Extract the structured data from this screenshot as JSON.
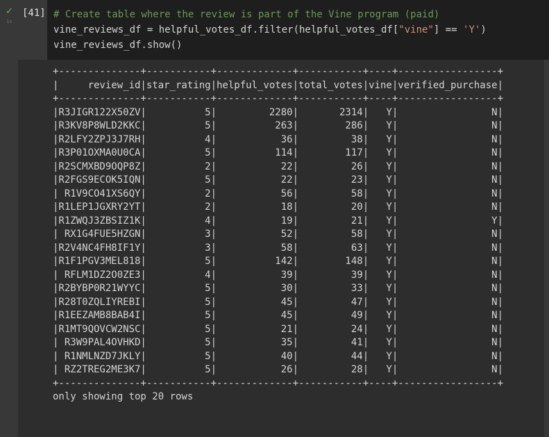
{
  "cell": {
    "status_icon": "✓",
    "exec_time": "1s",
    "execution_count": "[41]"
  },
  "code": {
    "comment": "# Create table where the review is part of the Vine program (paid)",
    "line2_a": "vine_reviews_df = helpful_votes_df.filter(helpful_votes_df[",
    "line2_str": "\"vine\"",
    "line2_b": "] == ",
    "line2_str2": "'Y'",
    "line2_c": ")",
    "line3": "vine_reviews_df.show()"
  },
  "output": {
    "columns": [
      "review_id",
      "star_rating",
      "helpful_votes",
      "total_votes",
      "vine",
      "verified_purchase"
    ],
    "rows": [
      [
        "R3JIGR122X50ZV",
        "5",
        "2280",
        "2314",
        "Y",
        "N"
      ],
      [
        "R3KV8P8WLD2KKC",
        "5",
        "263",
        "286",
        "Y",
        "N"
      ],
      [
        "R2LFY2ZPJ3J7RH",
        "4",
        "36",
        "38",
        "Y",
        "N"
      ],
      [
        "R3P01OXMA0U0CA",
        "5",
        "114",
        "117",
        "Y",
        "N"
      ],
      [
        "R2SCMXBD9OQP8Z",
        "2",
        "22",
        "26",
        "Y",
        "N"
      ],
      [
        "R2FGS9ECOK5IQN",
        "5",
        "22",
        "23",
        "Y",
        "N"
      ],
      [
        "R1V9CO41XS6QY",
        "2",
        "56",
        "58",
        "Y",
        "N"
      ],
      [
        "R1LEP1JGXRY2YT",
        "2",
        "18",
        "20",
        "Y",
        "N"
      ],
      [
        "R1ZWQJ3ZBSIZ1K",
        "4",
        "19",
        "21",
        "Y",
        "Y"
      ],
      [
        "RX1G4FUE5HZGN",
        "3",
        "52",
        "58",
        "Y",
        "N"
      ],
      [
        "R2V4NC4FH8IF1Y",
        "3",
        "58",
        "63",
        "Y",
        "N"
      ],
      [
        "R1F1PGV3MEL818",
        "5",
        "142",
        "148",
        "Y",
        "N"
      ],
      [
        "RFLM1DZ2O0ZE3",
        "4",
        "39",
        "39",
        "Y",
        "N"
      ],
      [
        "R2BYBP0R21WYYC",
        "5",
        "30",
        "33",
        "Y",
        "N"
      ],
      [
        "R28T0ZQLIYREBI",
        "5",
        "45",
        "47",
        "Y",
        "N"
      ],
      [
        "R1EEZAMB8BAB4I",
        "5",
        "45",
        "49",
        "Y",
        "N"
      ],
      [
        "R1MT9QOVCW2NSC",
        "5",
        "21",
        "24",
        "Y",
        "N"
      ],
      [
        "R3W9PAL4OVHKD",
        "5",
        "35",
        "41",
        "Y",
        "N"
      ],
      [
        "R1NMLNZD7JKLY",
        "5",
        "40",
        "44",
        "Y",
        "N"
      ],
      [
        "RZ2TREG2ME3K7",
        "5",
        "26",
        "28",
        "Y",
        "N"
      ]
    ],
    "footer": "only showing top 20 rows"
  }
}
